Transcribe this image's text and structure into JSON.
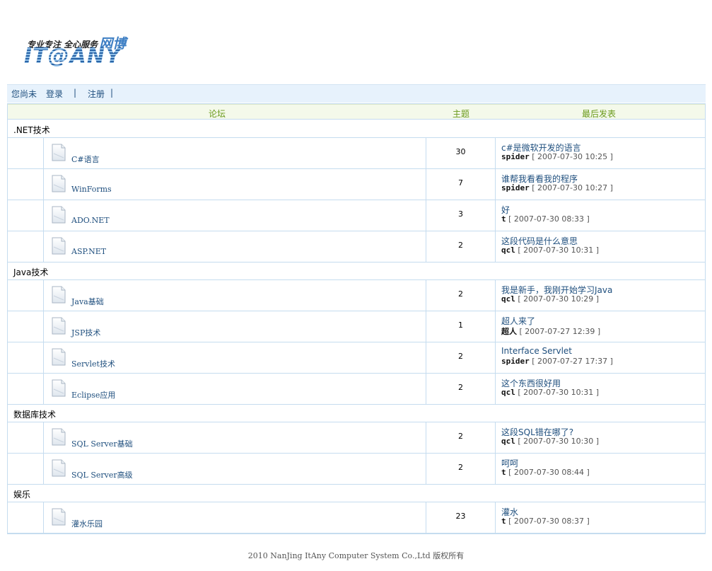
{
  "logo": {
    "slogan": "专业专注 全心服务",
    "brand_cn": "网博",
    "brand": "IT@ANY"
  },
  "userbar": {
    "status": "您尚未",
    "login": "登录",
    "sep1": "|",
    "register": "注册",
    "sep2": "|"
  },
  "table": {
    "col_forum": "论坛",
    "col_topics": "主题",
    "col_last": "最后发表"
  },
  "categories": [
    {
      "name": ".NET技术",
      "forums": [
        {
          "name": "C#语言",
          "topics": "30",
          "last_title": "c#是微软开发的语言",
          "author": "spider",
          "time": "[ 2007-07-30 10:25 ]"
        },
        {
          "name": "WinForms",
          "topics": "7",
          "last_title": "谁帮我看看我的程序",
          "author": "spider",
          "time": "[ 2007-07-30 10:27 ]"
        },
        {
          "name": "ADO.NET",
          "topics": "3",
          "last_title": "好",
          "author": "t",
          "time": "[ 2007-07-30 08:33 ]"
        },
        {
          "name": "ASP.NET",
          "topics": "2",
          "last_title": "这段代码是什么意思",
          "author": "qcl",
          "time": "[ 2007-07-30 10:31 ]"
        }
      ]
    },
    {
      "name": "Java技术",
      "forums": [
        {
          "name": "Java基础",
          "topics": "2",
          "last_title": "我是新手，我刚开始学习Java",
          "author": "qcl",
          "time": "[ 2007-07-30 10:29 ]"
        },
        {
          "name": "JSP技术",
          "topics": "1",
          "last_title": "超人来了",
          "author": "超人",
          "time": "[ 2007-07-27 12:39 ]"
        },
        {
          "name": "Servlet技术",
          "topics": "2",
          "last_title": "Interface Servlet",
          "author": "spider",
          "time": "[ 2007-07-27 17:37 ]"
        },
        {
          "name": "Eclipse应用",
          "topics": "2",
          "last_title": "这个东西很好用",
          "author": "qcl",
          "time": "[ 2007-07-30 10:31 ]"
        }
      ]
    },
    {
      "name": "数据库技术",
      "forums": [
        {
          "name": "SQL Server基础",
          "topics": "2",
          "last_title": "这段SQL错在哪了?",
          "author": "qcl",
          "time": "[ 2007-07-30 10:30 ]"
        },
        {
          "name": "SQL Server高级",
          "topics": "2",
          "last_title": "呵呵",
          "author": "t",
          "time": "[ 2007-07-30 08:44 ]"
        }
      ]
    },
    {
      "name": "娱乐",
      "forums": [
        {
          "name": "灌水乐园",
          "topics": "23",
          "last_title": "灌水",
          "author": "t",
          "time": "[ 2007-07-30 08:37 ]"
        }
      ]
    }
  ],
  "footer": "2010 NanJing ItAny Computer System Co.,Ltd 版权所有"
}
